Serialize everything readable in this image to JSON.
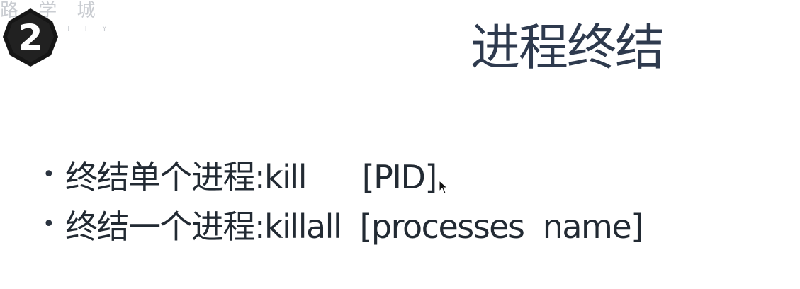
{
  "watermark": {
    "text": "路 学 城",
    "sub": "C I T Y"
  },
  "badge": {
    "number": "2",
    "icon": "number-badge-icon",
    "color": "#1a1a1a"
  },
  "title": "进程终结",
  "bullets": [
    {
      "text": "终结单个进程:kill      [PID]"
    },
    {
      "text": "终结一个进程:killall  [processes  name]"
    }
  ],
  "colors": {
    "title": "#2e3a4e",
    "body": "#222a33",
    "watermark": "#c9ccd1"
  }
}
